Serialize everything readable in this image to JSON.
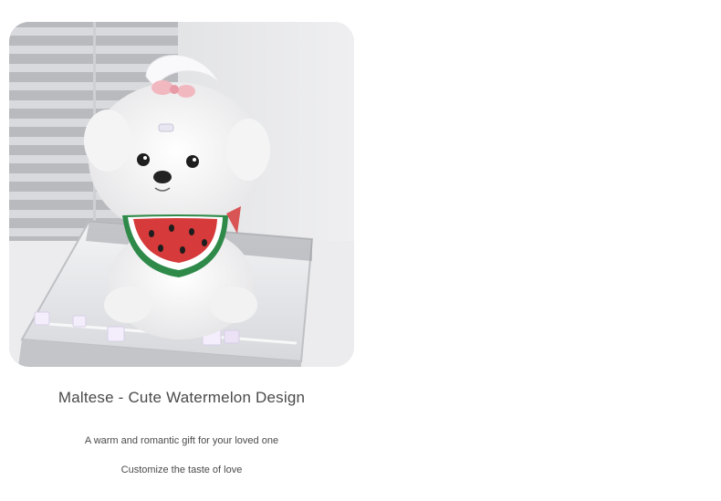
{
  "product": {
    "image_alt_icon": "maltese-plush-photo",
    "title": "Maltese - Cute Watermelon Design",
    "description": "A warm and romantic gift for your loved one",
    "tagline": "Customize the taste of love"
  },
  "colors": {
    "text": "#4a4a4a",
    "background": "#ffffff",
    "watermelon_red": "#d63a3a",
    "watermelon_green": "#2f8a4a",
    "bow_pink": "#f2b8c0"
  }
}
